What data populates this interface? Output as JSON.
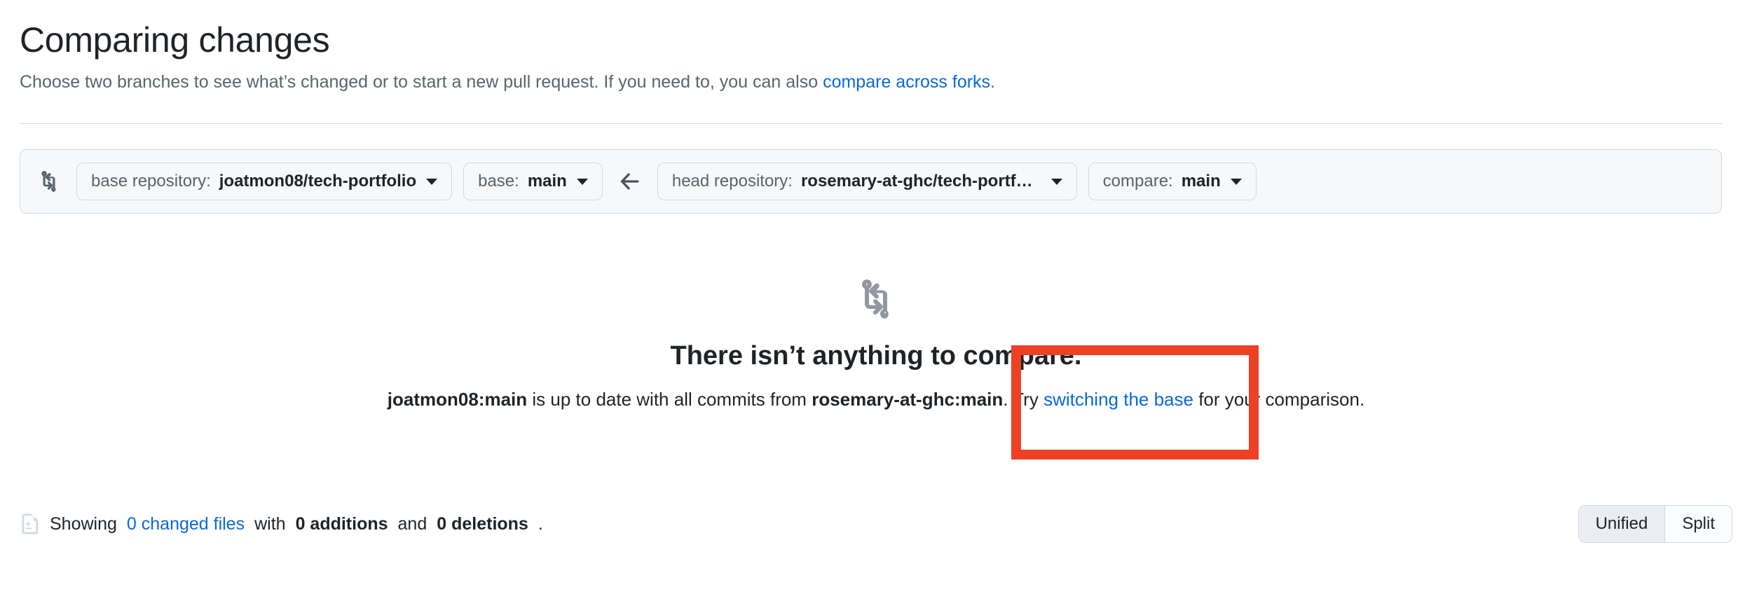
{
  "header": {
    "title": "Comparing changes",
    "subtitle_before": "Choose two branches to see what’s changed or to start a new pull request. If you need to, you can also ",
    "subtitle_link": "compare across forks",
    "subtitle_after": "."
  },
  "branch_bar": {
    "compare_icon": "git-compare-icon",
    "base_repository": {
      "prefix": "base repository:",
      "value": "joatmon08/tech-portfolio",
      "caret": "chevron-down-icon"
    },
    "base_branch": {
      "prefix": "base:",
      "value": "main",
      "caret": "chevron-down-icon"
    },
    "direction_icon": "arrow-left-icon",
    "head_repository": {
      "prefix": "head repository:",
      "value": "rosemary-at-ghc/tech-portf…",
      "caret": "chevron-down-icon"
    },
    "compare_branch": {
      "prefix": "compare:",
      "value": "main",
      "caret": "chevron-down-icon"
    }
  },
  "empty_state": {
    "icon": "git-compare-icon",
    "title": "There isn’t anything to compare.",
    "desc_base": "joatmon08:main",
    "desc_mid": " is up to date with all commits from ",
    "desc_head": "rosemary-at-ghc:main",
    "desc_try": ". Try ",
    "desc_link": "switching the base",
    "desc_end": " for your comparison."
  },
  "annotation": {
    "color": "#ee4024",
    "shape": "rectangle-highlight"
  },
  "footer": {
    "icon": "file-diff-icon",
    "showing": "Showing ",
    "changed_files": "0 changed files",
    "with": " with ",
    "additions": "0 additions",
    "and": " and ",
    "deletions": "0 deletions",
    "period": ".",
    "diff_view": {
      "unified": "Unified",
      "split": "Split",
      "selected": "Unified"
    }
  },
  "colors": {
    "link": "#0969da",
    "text": "#1f2328",
    "muted": "#59636e",
    "border": "#d1d9e0",
    "surface": "#f6f8fa",
    "annotation": "#ee4024"
  }
}
